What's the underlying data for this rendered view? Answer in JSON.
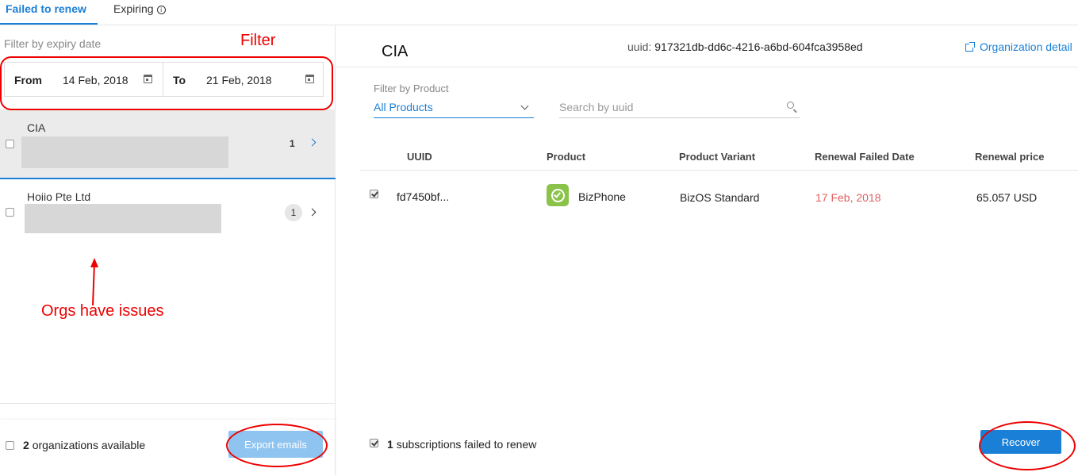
{
  "tabs": [
    {
      "label": "Failed to renew",
      "active": true
    },
    {
      "label": "Expiring",
      "active": false,
      "icon": "info-icon"
    }
  ],
  "left": {
    "filter_label": "Filter by expiry date",
    "date_from_label": "From",
    "date_from_value": "14 Feb, 2018",
    "date_to_label": "To",
    "date_to_value": "21 Feb, 2018",
    "orgs": [
      {
        "name": "CIA",
        "count": "1",
        "selected": true
      },
      {
        "name": "Hoiio Pte Ltd",
        "count": "1",
        "selected": false
      }
    ],
    "footer": {
      "count": "2",
      "count_suffix": "organizations available",
      "export_label": "Export emails"
    }
  },
  "right": {
    "title": "CIA",
    "uuid_label": "uuid:",
    "uuid_value": "917321db-dd6c-4216-a6bd-604fca3958ed",
    "org_detail_label": "Organization detail",
    "filter_product_label": "Filter by Product",
    "filter_product_value": "All Products",
    "search_placeholder": "Search by uuid",
    "columns": [
      "UUID",
      "Product",
      "Product Variant",
      "Renewal Failed Date",
      "Renewal price"
    ],
    "rows": [
      {
        "uuid": "fd7450bf...",
        "product": "BizPhone",
        "variant": "BizOS Standard",
        "date": "17 Feb, 2018",
        "price": "65.057 USD",
        "checked": true
      }
    ],
    "footer": {
      "count": "1",
      "count_suffix": "subscriptions failed to renew",
      "recover_label": "Recover"
    }
  },
  "annotations": {
    "filter": "Filter",
    "orgs": "Orgs have issues"
  },
  "colors": {
    "accent": "#1a7fd6",
    "danger": "#e06060",
    "annotation": "#ee0000"
  }
}
